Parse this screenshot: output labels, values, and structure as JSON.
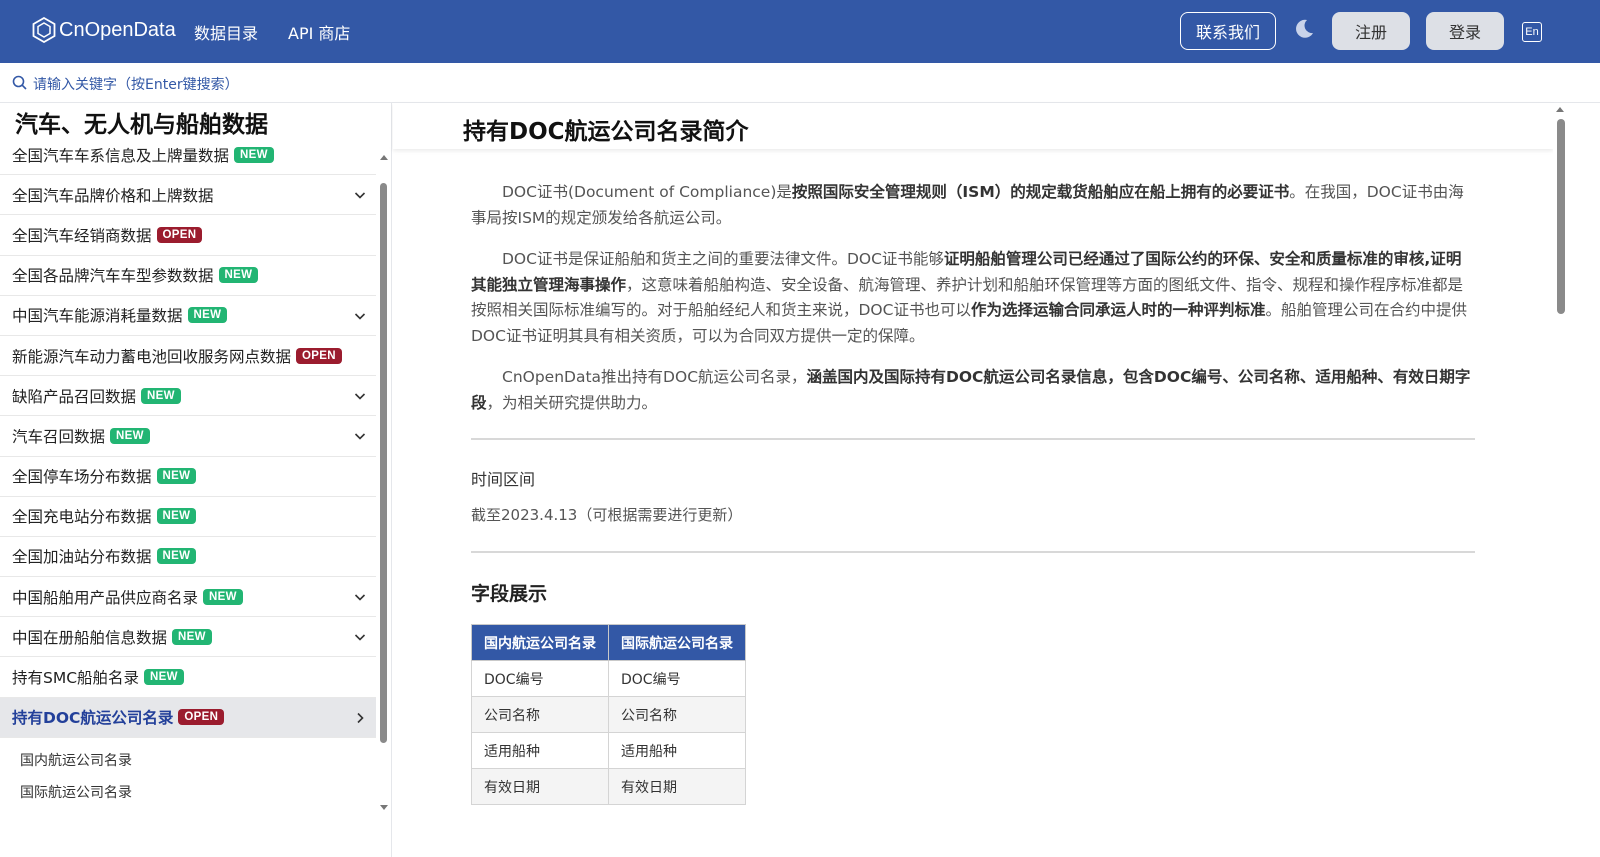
{
  "header": {
    "logo_text": "CnOpenData",
    "nav": [
      "数据目录",
      "API 商店"
    ],
    "contact_label": "联系我们",
    "register_label": "注册",
    "login_label": "登录",
    "lang_label": "En"
  },
  "search": {
    "placeholder": "请输入关键字（按Enter键搜索）"
  },
  "sidebar": {
    "title": "汽车、无人机与船舶数据",
    "items": [
      {
        "label": "全国汽车车系信息及上牌量数据",
        "badge": "NEW",
        "expandable": false
      },
      {
        "label": "全国汽车品牌价格和上牌数据",
        "badge": "",
        "expandable": true
      },
      {
        "label": "全国汽车经销商数据",
        "badge": "OPEN",
        "expandable": false
      },
      {
        "label": "全国各品牌汽车车型参数数据",
        "badge": "NEW",
        "expandable": false
      },
      {
        "label": "中国汽车能源消耗量数据",
        "badge": "NEW",
        "expandable": true
      },
      {
        "label": "新能源汽车动力蓄电池回收服务网点数据",
        "badge": "OPEN",
        "expandable": false
      },
      {
        "label": "缺陷产品召回数据",
        "badge": "NEW",
        "expandable": true
      },
      {
        "label": "汽车召回数据",
        "badge": "NEW",
        "expandable": true
      },
      {
        "label": "全国停车场分布数据",
        "badge": "NEW",
        "expandable": false
      },
      {
        "label": "全国充电站分布数据",
        "badge": "NEW",
        "expandable": false
      },
      {
        "label": "全国加油站分布数据",
        "badge": "NEW",
        "expandable": false
      },
      {
        "label": "中国船舶用产品供应商名录",
        "badge": "NEW",
        "expandable": true
      },
      {
        "label": "中国在册船舶信息数据",
        "badge": "NEW",
        "expandable": true
      },
      {
        "label": "持有SMC船舶名录",
        "badge": "NEW",
        "expandable": false
      },
      {
        "label": "持有DOC航运公司名录",
        "badge": "OPEN",
        "expandable": true,
        "active": true
      }
    ],
    "sub_items": [
      "国内航运公司名录",
      "国际航运公司名录"
    ]
  },
  "main": {
    "title": "持有DOC航运公司名录简介",
    "p1_a": "DOC证书(Document of Compliance)是",
    "p1_b": "按照国际安全管理规则（ISM）的规定载货船舶应在船上拥有的必要证书",
    "p1_c": "。在我国，DOC证书由海事局按ISM的规定颁发给各航运公司。",
    "p2_a": "DOC证书是保证船舶和货主之间的重要法律文件。DOC证书能够",
    "p2_b": "证明船舶管理公司已经通过了国际公约的环保、安全和质量标准的审核,证明其能独立管理海事操作",
    "p2_c": "，这意味着船舶构造、安全设备、航海管理、养护计划和船舶环保管理等方面的图纸文件、指令、规程和操作程序标准都是按照相关国际标准编写的。对于船舶经纪人和货主来说，DOC证书也可以",
    "p2_d": "作为选择运输合同承运人时的一种评判标准",
    "p2_e": "。船舶管理公司在合约中提供DOC证书证明其具有相关资质，可以为合同双方提供一定的保障。",
    "p3_a": "CnOpenData推出持有DOC航运公司名录，",
    "p3_b": "涵盖国内及国际持有DOC航运公司名录信息，包含DOC编号、公司名称、适用船种、有效日期字段",
    "p3_c": "，为相关研究提供助力。",
    "time_label": "时间区间",
    "time_value": "截至2023.4.13（可根据需要进行更新）",
    "fields_title": "字段展示",
    "table": {
      "headers": [
        "国内航运公司名录",
        "国际航运公司名录"
      ],
      "rows": [
        [
          "DOC编号",
          "DOC编号"
        ],
        [
          "公司名称",
          "公司名称"
        ],
        [
          "适用船种",
          "适用船种"
        ],
        [
          "有效日期",
          "有效日期"
        ]
      ]
    }
  },
  "colors": {
    "brand": "#3358a6",
    "new_badge": "#22b573",
    "open_badge": "#9b1c2e"
  }
}
